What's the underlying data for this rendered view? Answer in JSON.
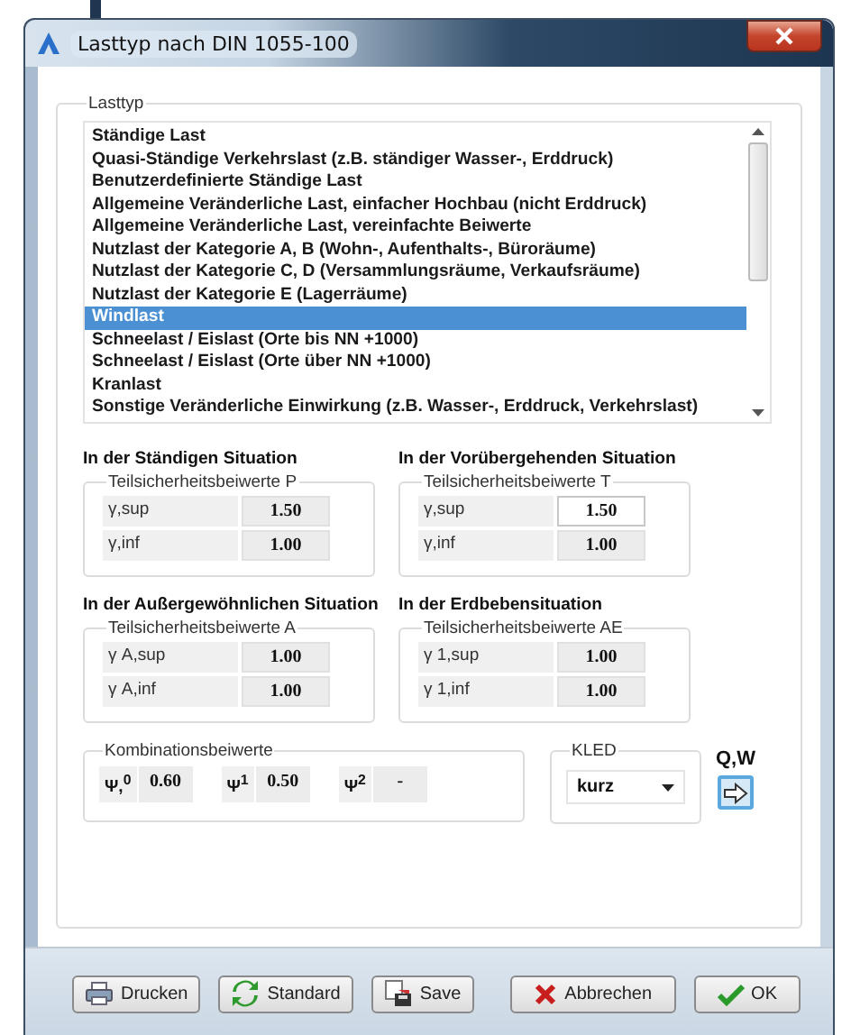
{
  "window": {
    "title": "Lasttyp nach DIN 1055-100"
  },
  "lasttyp": {
    "label": "Lasttyp",
    "items": [
      {
        "label": "Ständige Last",
        "selected": false
      },
      {
        "label": "Quasi-Ständige Verkehrslast (z.B. ständiger Wasser-, Erddruck)",
        "selected": false
      },
      {
        "label": "Benutzerdefinierte Ständige Last",
        "selected": false
      },
      {
        "label": "Allgemeine Veränderliche Last, einfacher Hochbau (nicht Erddruck)",
        "selected": false
      },
      {
        "label": "Allgemeine Veränderliche Last, vereinfachte Beiwerte",
        "selected": false
      },
      {
        "label": "Nutzlast der Kategorie A, B (Wohn-, Aufenthalts-, Büroräume)",
        "selected": false
      },
      {
        "label": "Nutzlast der Kategorie C, D (Versammlungsräume, Verkaufsräume)",
        "selected": false
      },
      {
        "label": "Nutzlast der Kategorie E (Lagerräume)",
        "selected": false
      },
      {
        "label": "Windlast",
        "selected": true
      },
      {
        "label": "Schneelast / Eislast (Orte bis NN +1000)",
        "selected": false
      },
      {
        "label": "Schneelast / Eislast (Orte über NN +1000)",
        "selected": false
      },
      {
        "label": "Kranlast",
        "selected": false
      },
      {
        "label": "Sonstige Veränderliche Einwirkung (z.B. Wasser-, Erddruck, Verkehrslast)",
        "selected": false
      }
    ]
  },
  "situations": [
    {
      "heading": "In der Ständigen Situation",
      "group_label": "Teilsicherheitsbeiwerte P",
      "rows": [
        {
          "label": "γ,sup",
          "value": "1.50",
          "editable": false
        },
        {
          "label": "γ,inf",
          "value": "1.00",
          "editable": false
        }
      ]
    },
    {
      "heading": "In der Vorübergehenden Situation",
      "group_label": "Teilsicherheitsbeiwerte T",
      "rows": [
        {
          "label": "γ,sup",
          "value": "1.50",
          "editable": true
        },
        {
          "label": "γ,inf",
          "value": "1.00",
          "editable": false
        }
      ]
    },
    {
      "heading": "In der Außergewöhnlichen Situation",
      "group_label": "Teilsicherheitsbeiwerte A",
      "rows": [
        {
          "label": "γ A,sup",
          "value": "1.00",
          "editable": false
        },
        {
          "label": "γ A,inf",
          "value": "1.00",
          "editable": false
        }
      ]
    },
    {
      "heading": "In der Erdbebensituation",
      "group_label": "Teilsicherheitsbeiwerte AE",
      "rows": [
        {
          "label": "γ 1,sup",
          "value": "1.00",
          "editable": false
        },
        {
          "label": "γ 1,inf",
          "value": "1.00",
          "editable": false
        }
      ]
    }
  ],
  "kombinationsbeiwerte": {
    "label": "Kombinationsbeiwerte",
    "items": [
      {
        "label": "Ψ,$^{0}$",
        "value": "0.60"
      },
      {
        "label": "Ψ$^{1}$",
        "value": "0.50"
      },
      {
        "label": "Ψ$^{2}$",
        "value": "-"
      }
    ]
  },
  "kled": {
    "label": "KLED",
    "value": "kurz"
  },
  "qw": {
    "label": "Q,W"
  },
  "buttons": [
    {
      "label": "Drucken",
      "kind": "print"
    },
    {
      "label": "Standard",
      "kind": "reset"
    },
    {
      "label": "Save",
      "kind": "save"
    },
    {
      "label": "Abbrechen",
      "kind": "cancel"
    },
    {
      "label": "OK",
      "kind": "ok"
    }
  ]
}
